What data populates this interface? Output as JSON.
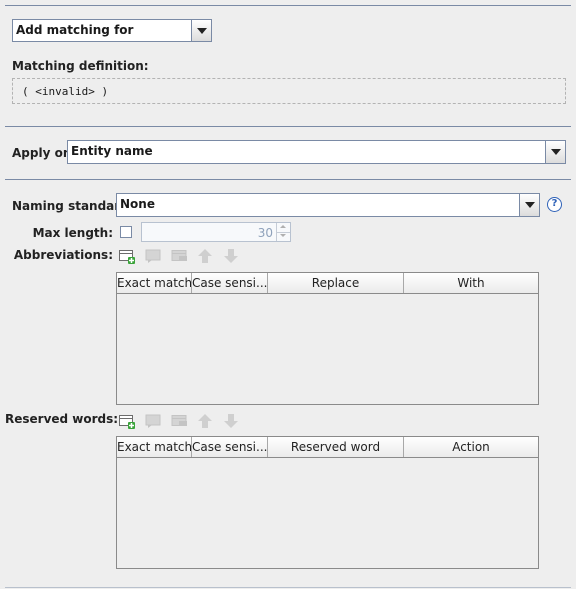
{
  "matching": {
    "combo_value": "Add matching for",
    "definition_label": "Matching definition:",
    "definition_value": "( <invalid> )"
  },
  "apply_on": {
    "label": "Apply on:",
    "value": "Entity name"
  },
  "naming": {
    "label": "Naming standard:",
    "value": "None",
    "help_icon": "?"
  },
  "max_length": {
    "label": "Max length:",
    "checked": false,
    "value": "30"
  },
  "abbreviations": {
    "label": "Abbreviations:",
    "columns": [
      "Exact match",
      "Case sensi...",
      "Replace",
      "With"
    ],
    "rows": []
  },
  "reserved": {
    "label": "Reserved words:",
    "columns": [
      "Exact match",
      "Case sensi...",
      "Reserved word",
      "Action"
    ],
    "rows": []
  },
  "toolbar_icons": [
    "add-row-icon",
    "edit-row-icon",
    "delete-row-icon",
    "move-up-icon",
    "move-down-icon"
  ],
  "colors": {
    "border": "#7a8aa5",
    "background": "#eeeeee",
    "accent": "#2f62b8"
  }
}
